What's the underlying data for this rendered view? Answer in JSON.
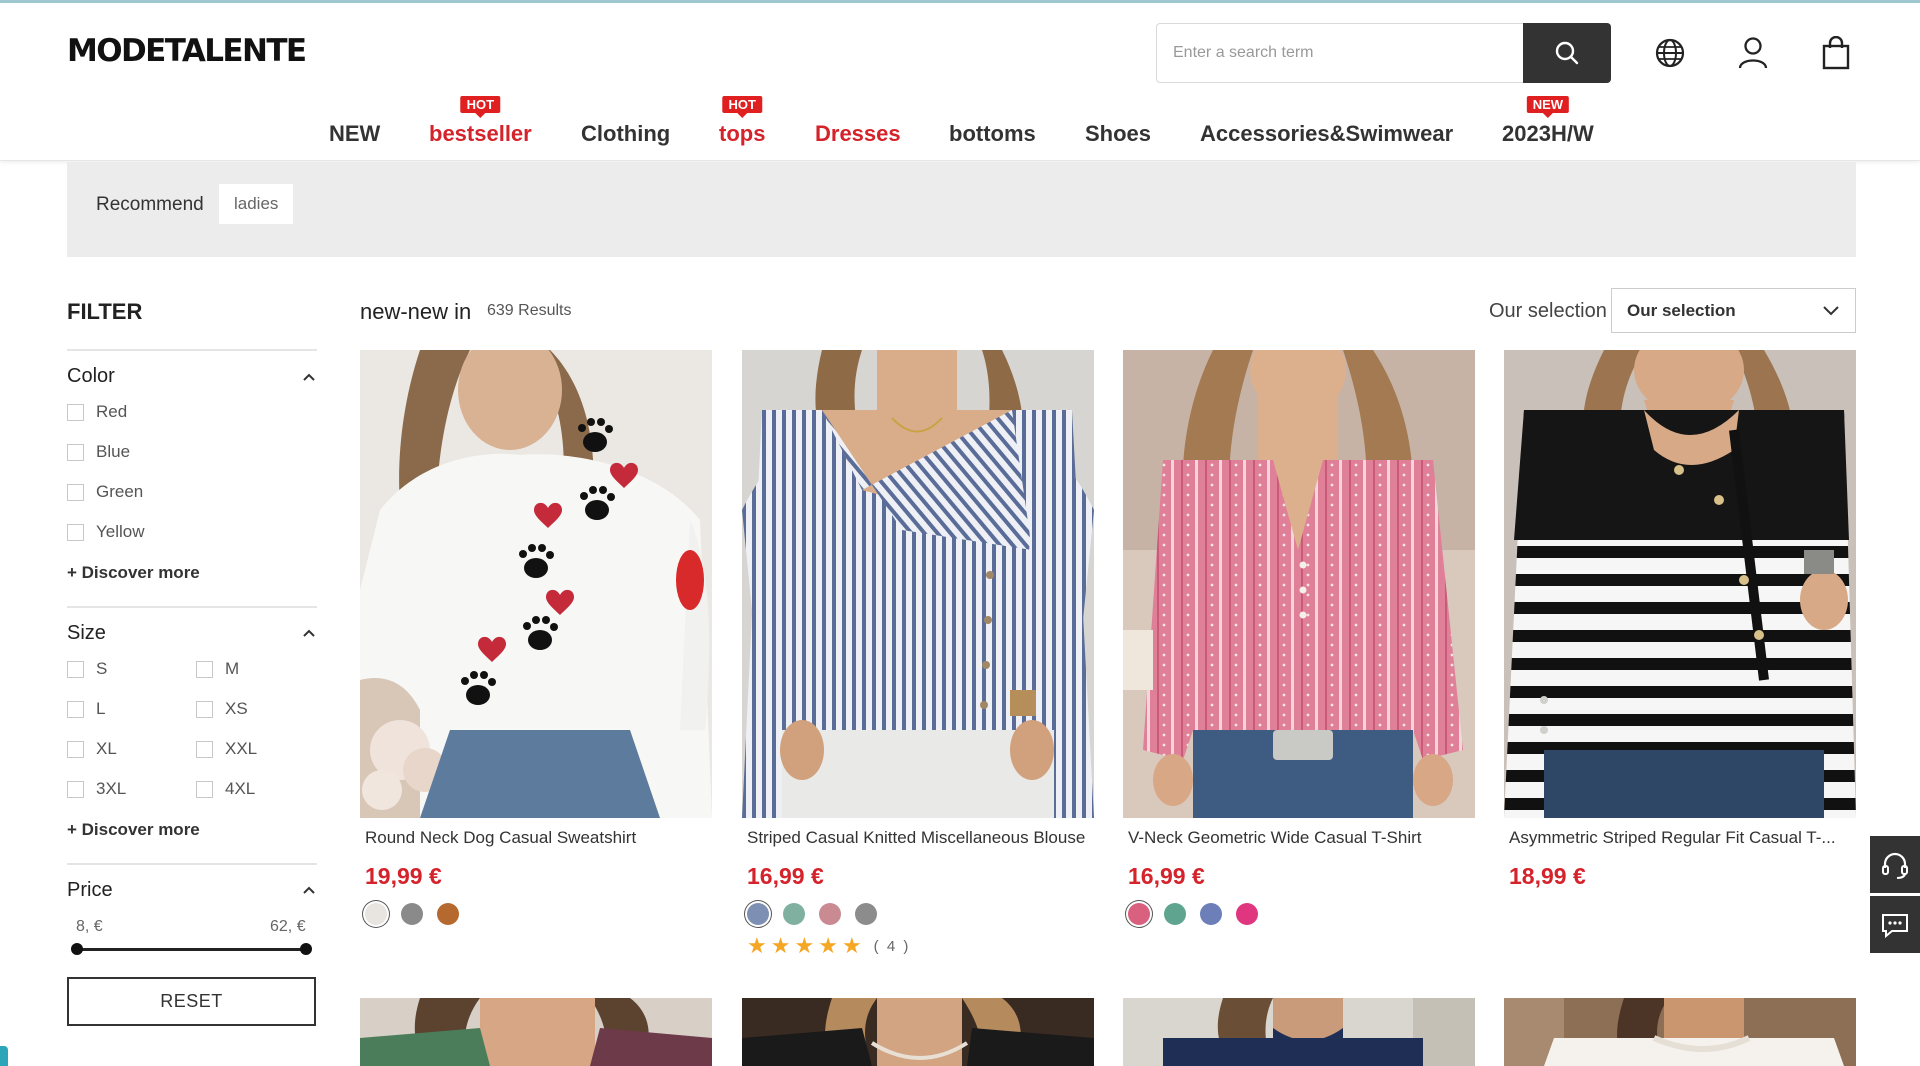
{
  "header": {
    "logo": "MODETALENTE",
    "search_placeholder": "Enter a search term"
  },
  "nav": [
    {
      "label": "NEW",
      "badge": "",
      "highlight": false
    },
    {
      "label": "bestseller",
      "badge": "HOT",
      "highlight": true
    },
    {
      "label": "Clothing",
      "badge": "",
      "highlight": false
    },
    {
      "label": "tops",
      "badge": "HOT",
      "highlight": true
    },
    {
      "label": "Dresses",
      "badge": "",
      "highlight": true
    },
    {
      "label": "bottoms",
      "badge": "",
      "highlight": false
    },
    {
      "label": "Shoes",
      "badge": "",
      "highlight": false
    },
    {
      "label": "Accessories&Swimwear",
      "badge": "",
      "highlight": false
    },
    {
      "label": "2023H/W",
      "badge": "NEW",
      "highlight": false
    }
  ],
  "recommend": {
    "label": "Recommend",
    "tags": [
      "ladies"
    ]
  },
  "filter": {
    "title": "FILTER",
    "color": {
      "title": "Color",
      "options": [
        "Red",
        "Blue",
        "Green",
        "Yellow"
      ],
      "more": "+ Discover more"
    },
    "size": {
      "title": "Size",
      "options": [
        "S",
        "M",
        "L",
        "XS",
        "XL",
        "XXL",
        "3XL",
        "4XL"
      ],
      "more": "+ Discover more"
    },
    "price": {
      "title": "Price",
      "min_label": "8, €",
      "max_label": "62, €",
      "range_fraction": [
        0,
        1
      ]
    },
    "reset": "RESET"
  },
  "listing": {
    "title": "new-new in",
    "count": "639 Results",
    "sort_label": "Our selection",
    "sort_value": "Our selection"
  },
  "products": [
    {
      "name": "Round Neck Dog Casual Sweatshirt",
      "price": "19,99 €",
      "swatches": [
        "#e8e4df",
        "#8a8a8a",
        "#b5692e"
      ],
      "rating": null,
      "review_count": ""
    },
    {
      "name": "Striped Casual Knitted Miscellaneous Blouse",
      "price": "16,99 €",
      "swatches": [
        "#7d8fb3",
        "#7fb0a0",
        "#c98a92",
        "#8c8c8c"
      ],
      "rating": 5,
      "review_count": "( 4 )"
    },
    {
      "name": "V-Neck Geometric Wide Casual T-Shirt",
      "price": "16,99 €",
      "swatches": [
        "#d9607e",
        "#5fa48e",
        "#6d7fb8",
        "#e0357f"
      ],
      "rating": null,
      "review_count": ""
    },
    {
      "name": "Asymmetric Striped Regular Fit Casual T-...",
      "price": "18,99 €",
      "swatches": [],
      "rating": null,
      "review_count": ""
    }
  ],
  "colors": {
    "accent_red": "#d4232b",
    "dark": "#333333",
    "badge_red": "#e02020",
    "recommend_bg": "#ececec"
  },
  "icons": [
    "search-icon",
    "globe-icon",
    "user-icon",
    "bag-icon",
    "chevron-up-icon",
    "chevron-down-icon",
    "headset-icon",
    "chat-icon",
    "star-icon"
  ]
}
